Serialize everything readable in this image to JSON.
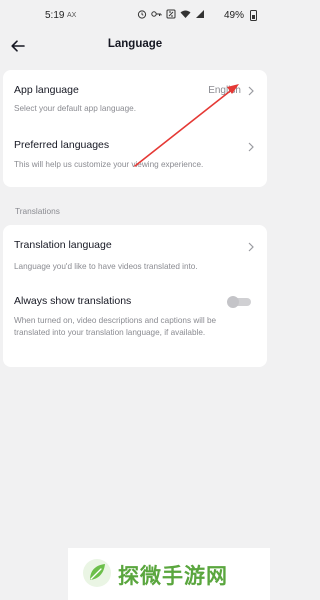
{
  "status_bar": {
    "time": "5:19",
    "carrier": "AX",
    "battery": "49%"
  },
  "header": {
    "title": "Language"
  },
  "app_language_card": {
    "app_language": {
      "title": "App language",
      "subtitle": "Select your default app language.",
      "value": "English"
    },
    "preferred_languages": {
      "title": "Preferred languages",
      "subtitle": "This will help us customize your viewing experience."
    }
  },
  "translations_section": {
    "header": "Translations",
    "translation_language": {
      "title": "Translation language",
      "subtitle": "Language you'd like to have videos translated into."
    },
    "always_show_translations": {
      "title": "Always show translations",
      "subtitle": "When turned on, video descriptions and captions will be translated into your translation language, if available.",
      "enabled": false
    }
  },
  "watermark": {
    "text": "探微手游网"
  },
  "colors": {
    "background": "#f1f1f2",
    "card": "#ffffff",
    "primary_text": "#161823",
    "secondary_text": "#8a8b91",
    "annotation_arrow": "#e53935",
    "watermark_green": "#5aa63e"
  }
}
